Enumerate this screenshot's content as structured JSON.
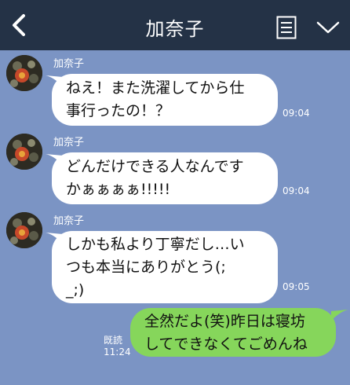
{
  "header": {
    "title": "加奈子"
  },
  "messages": [
    {
      "sender": "加奈子",
      "line1": "ねえ！また洗濯してから仕",
      "line2": "事行ったの！？",
      "time": "09:04"
    },
    {
      "sender": "加奈子",
      "line1": "どんだけできる人なんです",
      "line2": "かぁぁぁぁ!!!!!",
      "time": "09:04"
    },
    {
      "sender": "加奈子",
      "line1": "しかも私より丁寧だし…い",
      "line2": "つも本当にありがとう(;",
      "line3": "_;)",
      "time": "09:05"
    }
  ],
  "outgoing": {
    "line1": "全然だよ(笑)昨日は寝坊",
    "line2": "してできなくてごめんね",
    "read_label": "既読",
    "time": "11:24"
  },
  "colors": {
    "header_bg": "#243246",
    "chat_bg": "#7b94c4",
    "incoming_bubble": "#ffffff",
    "outgoing_bubble": "#86d65b"
  },
  "icons": [
    "back-arrow-icon",
    "menu-list-icon",
    "chevron-down-icon"
  ]
}
